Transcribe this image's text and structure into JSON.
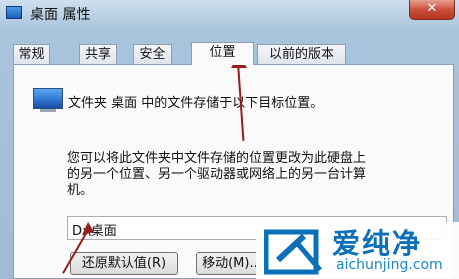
{
  "window": {
    "title": "桌面 属性",
    "close_glyph": "✕"
  },
  "tabs": [
    {
      "label": "常规"
    },
    {
      "label": "共享"
    },
    {
      "label": "安全"
    },
    {
      "label": "位置",
      "active": true
    },
    {
      "label": "以前的版本"
    }
  ],
  "location": {
    "line1": "文件夹 桌面 中的文件存储于以下目标位置。",
    "desc1": "您可以将此文件夹中文件存储的位置更改为此硬盘上",
    "desc2": "的另一个位置、另一个驱动器或网络上的另一台计算",
    "desc3": "机。",
    "path_value": "D:\\桌面",
    "restore_button": "还原默认值(R)",
    "move_button": "移动(M)..."
  },
  "watermark": {
    "cn": "爱纯净",
    "en": "aichunjing.com"
  },
  "colors": {
    "arrow": "#9b1b1b",
    "watermark_blue": "#0d6fb8"
  }
}
